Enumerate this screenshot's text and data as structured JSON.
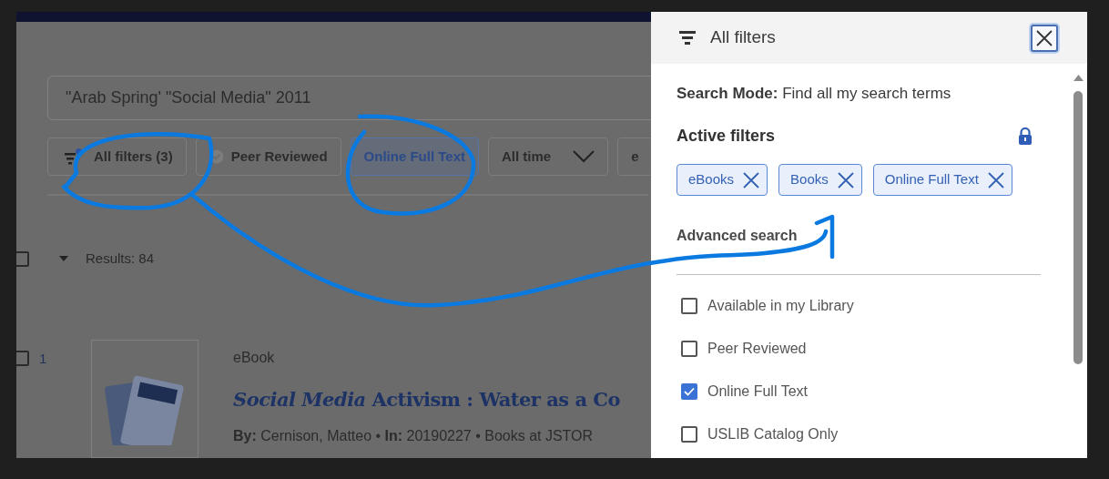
{
  "search": {
    "value": "\"Arab Spring' \"Social Media\" 2011"
  },
  "filter_chips": [
    {
      "kind": "all-filters",
      "label": "All filters (3)",
      "selected": false
    },
    {
      "kind": "verified",
      "label": "Peer Reviewed",
      "selected": false
    },
    {
      "kind": "plain",
      "label": "Online Full Text",
      "selected": true
    },
    {
      "kind": "dropdown",
      "label": "All time",
      "selected": false
    },
    {
      "kind": "plain",
      "label": "e",
      "selected": false
    }
  ],
  "results": {
    "count_label": "Results: 84",
    "checked": false
  },
  "result_items": [
    {
      "checked": false,
      "number": "1",
      "type": "eBook",
      "title": "*Social* *Media* Activism : Water as a Co",
      "byline": "**By:** Cernison, Matteo  • **In:** 20190227 • Books at JSTOR"
    }
  ],
  "panel": {
    "title": "All filters",
    "search_mode": "**Search Mode:** Find all my search terms",
    "active_filters_heading": "Active filters",
    "active_filters": [
      "eBooks",
      "Books",
      "Online Full Text"
    ],
    "advanced_search": "Advanced search",
    "options": [
      {
        "label": "Available in my Library",
        "checked": false
      },
      {
        "label": "Peer Reviewed",
        "checked": false
      },
      {
        "label": "Online Full Text",
        "checked": true
      },
      {
        "label": "USLIB Catalog Only",
        "checked": false
      }
    ]
  }
}
